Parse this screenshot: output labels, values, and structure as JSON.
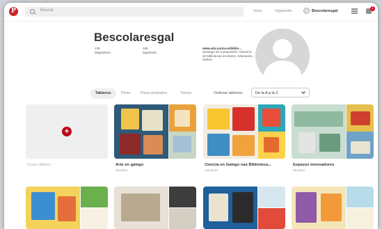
{
  "header": {
    "logo": "P",
    "search_placeholder": "Buscar",
    "nav_home": "Inicio",
    "nav_following": "Siguiendo",
    "nav_user": "Bescolaresgal",
    "notifications_count": "1"
  },
  "profile": {
    "name": "Bescolaresgal",
    "followers_count": "125",
    "followers_label": "Seguidores",
    "following_count": "166",
    "following_label": "Siguiendo",
    "website": "www.edu.xunta.es/biblio...",
    "description": "Santiago de Compostela / Asesoría de bibliotecas escolares. Educación. Galicia"
  },
  "tabs": [
    {
      "label": "Tableros",
      "active": true
    },
    {
      "label": "Pines",
      "active": false
    },
    {
      "label": "Pines probados",
      "active": false
    },
    {
      "label": "Temas",
      "active": false
    }
  ],
  "sort": {
    "label": "Ordenar tableros",
    "value": "De la A a la Z"
  },
  "boards": [
    {
      "title": "Crear tablero",
      "count": ""
    },
    {
      "title": "Arte en galego",
      "count": "49 pines"
    },
    {
      "title": "Ciencia en Galego nas Biblioteca...",
      "count": "125 pines"
    },
    {
      "title": "Espazos innovadores",
      "count": "59 pines"
    }
  ],
  "colors": {
    "brand": "#bd081c",
    "tab_active_bg": "#efefef"
  }
}
